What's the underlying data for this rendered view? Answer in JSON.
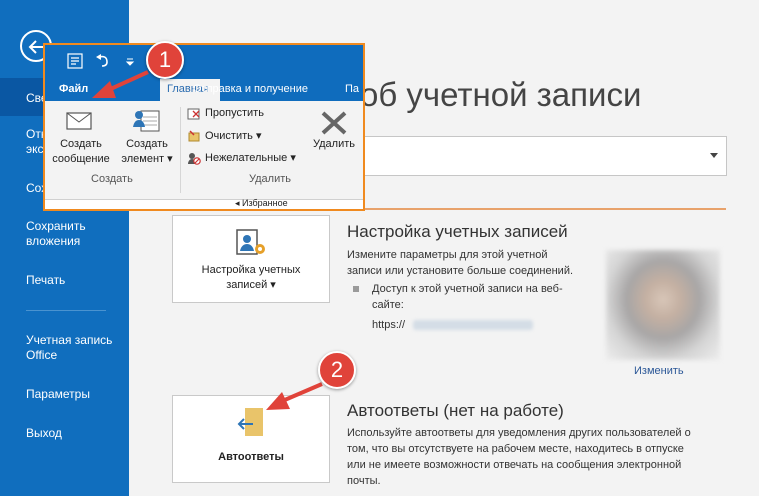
{
  "sidebar": {
    "items": [
      {
        "label": "Све"
      },
      {
        "label": "Отк\nэкс"
      },
      {
        "label": "Сох"
      },
      {
        "label": "Сохранить\nвложения"
      },
      {
        "label": "Печать"
      },
      {
        "label": "Учетная запись\nOffice"
      },
      {
        "label": "Параметры"
      },
      {
        "label": "Выход"
      }
    ]
  },
  "main": {
    "title": "об учетной записи",
    "account_settings": {
      "button_label": "Настройка учетных\nзаписей ▾",
      "heading": "Настройка учетных записей",
      "description": "Измените параметры для этой учетной\nзаписи или установите больше соединений.",
      "bullet": "Доступ к этой учетной записи на веб-\nсайте:",
      "url_prefix": "https://"
    },
    "change_link": "Изменить",
    "autoreply": {
      "button_label": "Автоответы",
      "heading": "Автоответы (нет на работе)",
      "description": "Используйте автоответы для уведомления других пользователей о\nтом, что вы отсутствуете на рабочем месте, находитесь в отпуске\nили не имеете возможности отвечать на сообщения электронной\nпочты."
    }
  },
  "ribbon": {
    "tabs": {
      "file": "Файл",
      "home": "Главная",
      "send_receive": "Отправка и получение",
      "folder_partial": "Па"
    },
    "create_message": "Создать\nсообщение",
    "create_item": "Создать\nэлемент ▾",
    "group_create": "Создать",
    "skip": "Пропустить",
    "clean": "Очистить ▾",
    "junk": "Нежелательные ▾",
    "delete": "Удалить",
    "group_delete": "Удалить",
    "folder_strip": "◂ Избранное"
  },
  "annotations": {
    "badge1": "1",
    "badge2": "2",
    "accent_color": "#e0433a",
    "highlight_color": "#f08a1f"
  }
}
